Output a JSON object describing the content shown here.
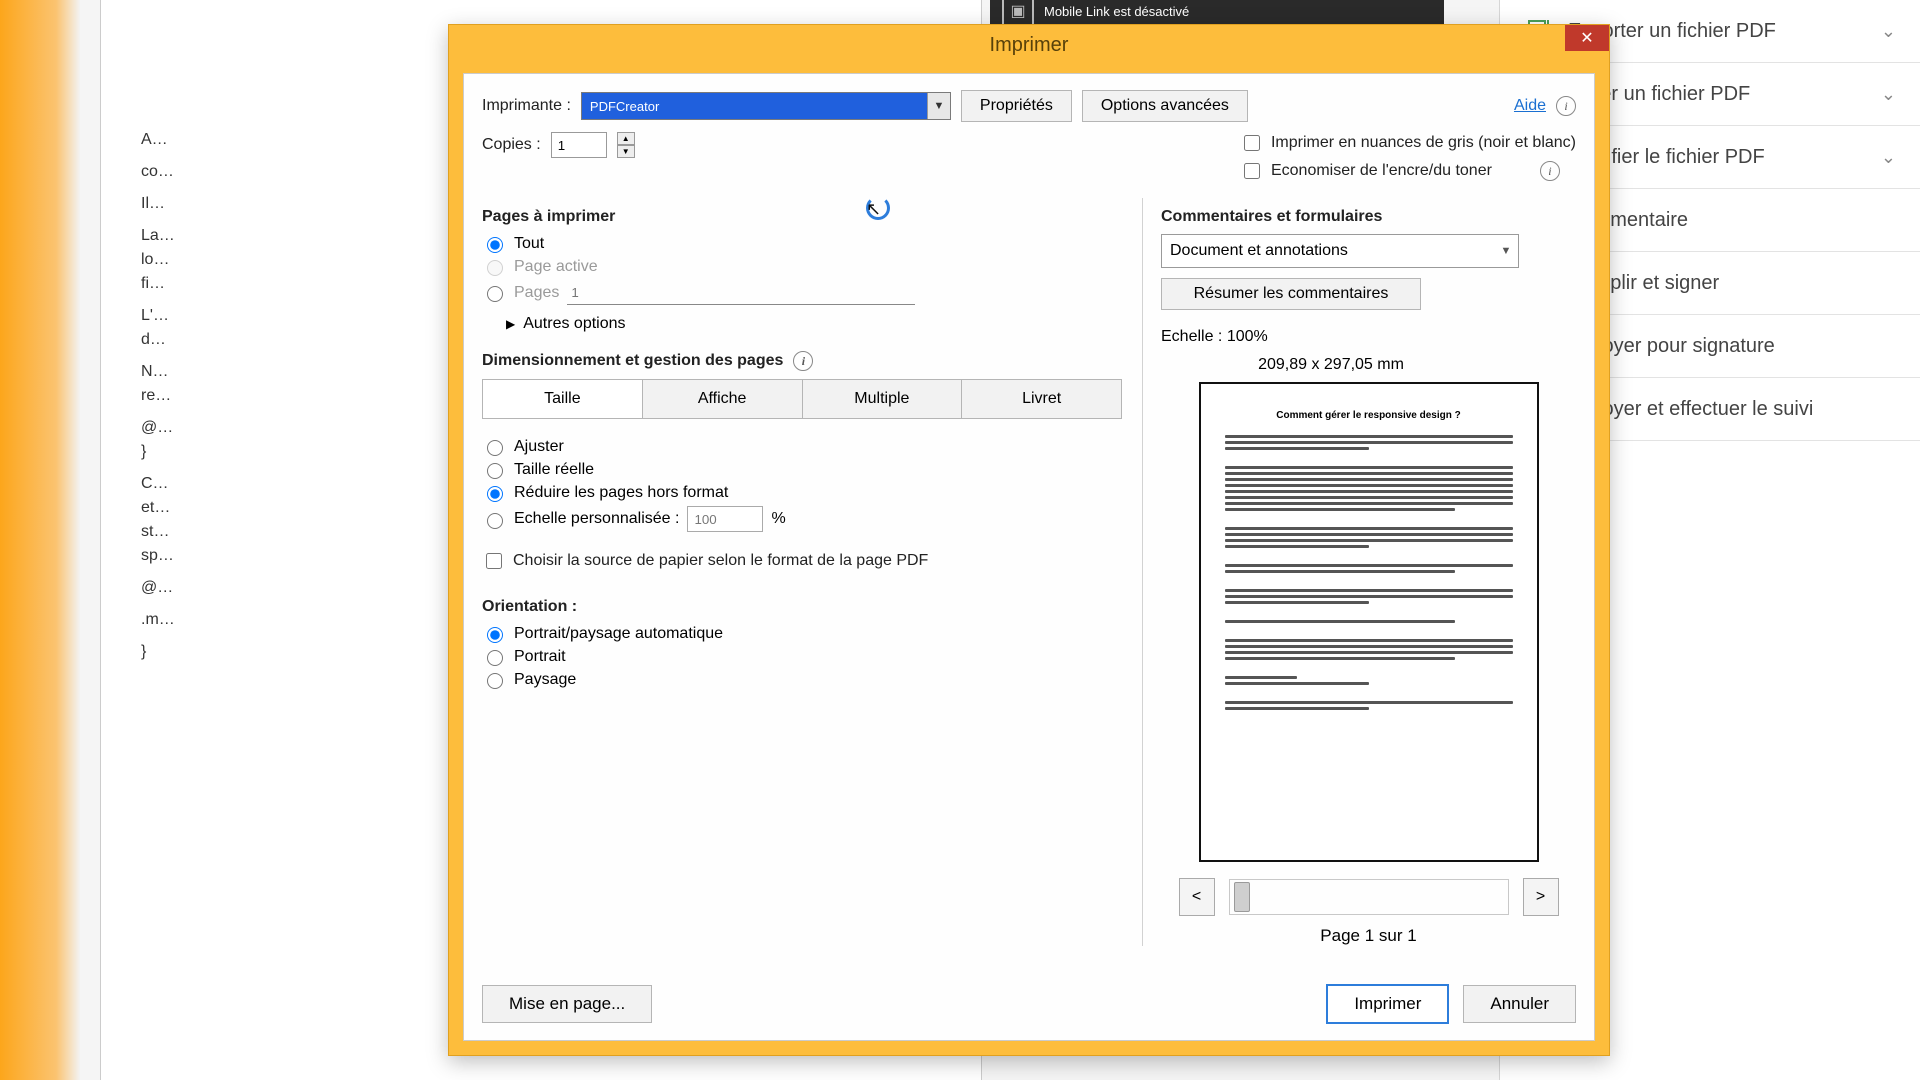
{
  "bg_tools": [
    {
      "label": "Exporter un fichier PDF"
    },
    {
      "label": "Créer un fichier PDF"
    },
    {
      "label": "Modifier le fichier PDF"
    },
    {
      "label": "Commentaire"
    },
    {
      "label": "Remplir et signer"
    },
    {
      "label": "Envoyer pour signature"
    },
    {
      "label": "Envoyer et effectuer le suivi"
    }
  ],
  "toast": {
    "title": "Mobile Link est désactivé"
  },
  "dialog": {
    "title": "Imprimer",
    "close": "✕",
    "printer_label": "Imprimante :",
    "printer_value": "PDFCreator",
    "properties_btn": "Propriétés",
    "advanced_btn": "Options avancées",
    "help_link": "Aide",
    "copies_label": "Copies :",
    "copies_value": "1",
    "grayscale_label": "Imprimer en nuances de gris (noir et blanc)",
    "savetoner_label": "Economiser de l'encre/du toner",
    "pages_section": "Pages à imprimer",
    "radio_all": "Tout",
    "radio_active": "Page active",
    "radio_pages": "Pages",
    "pages_placeholder": "1",
    "more_options": "Autres options",
    "sizing_section": "Dimensionnement et gestion des pages",
    "seg_size": "Taille",
    "seg_poster": "Affiche",
    "seg_multiple": "Multiple",
    "seg_booklet": "Livret",
    "fit": "Ajuster",
    "actual": "Taille réelle",
    "shrink": "Réduire les pages hors format",
    "custom_scale": "Echelle personnalisée :",
    "custom_scale_val": "100",
    "percent": "%",
    "paper_source": "Choisir la source de papier selon le format de la page PDF",
    "orientation_section": "Orientation :",
    "orient_auto": "Portrait/paysage automatique",
    "orient_portrait": "Portrait",
    "orient_landscape": "Paysage",
    "comments_section": "Commentaires et formulaires",
    "comments_select": "Document et annotations",
    "summarize_btn": "Résumer les commentaires",
    "scale_label": "Echelle : 100%",
    "paper_dims": "209,89 x 297,05 mm",
    "preview_title": "Comment gérer le responsive design ?",
    "prev": "<",
    "next": ">",
    "page_of": "Page 1 sur 1",
    "page_setup": "Mise en page...",
    "print_btn": "Imprimer",
    "cancel_btn": "Annuler"
  }
}
